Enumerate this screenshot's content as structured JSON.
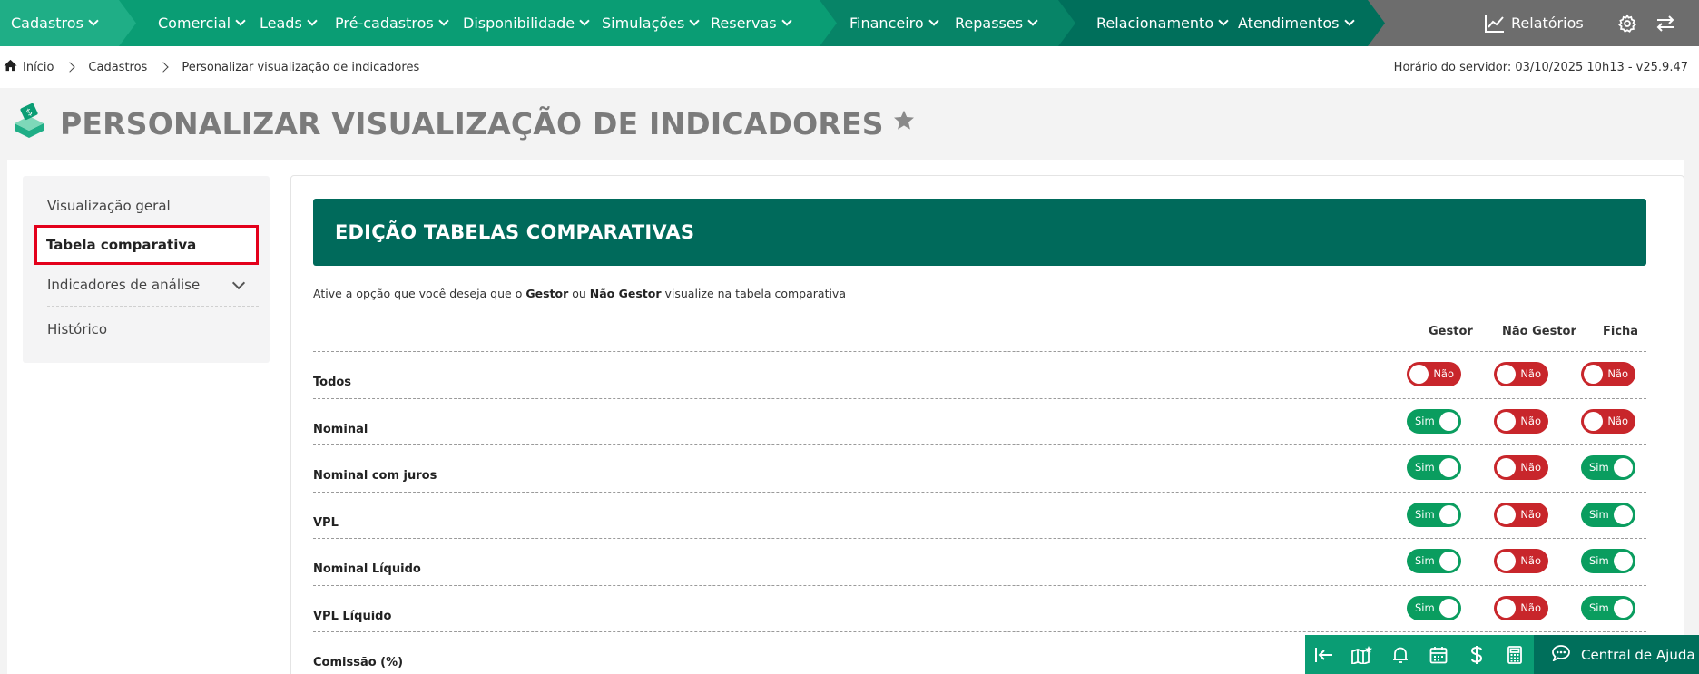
{
  "nav": {
    "items": [
      {
        "label": "Cadastros"
      },
      {
        "label": "Comercial"
      },
      {
        "label": "Leads"
      },
      {
        "label": "Pré-cadastros"
      },
      {
        "label": "Disponibilidade"
      },
      {
        "label": "Simulações"
      },
      {
        "label": "Reservas"
      },
      {
        "label": "Financeiro"
      },
      {
        "label": "Repasses"
      },
      {
        "label": "Relacionamento"
      },
      {
        "label": "Atendimentos"
      }
    ],
    "reports_label": "Relatórios",
    "colors": {
      "seg1": "#1fae86",
      "seg2": "#0a9d74",
      "seg3": "#078467",
      "seg4": "#006f5b",
      "right": "#6d6d6d"
    }
  },
  "breadcrumb": {
    "home": "Início",
    "items": [
      "Cadastros",
      "Personalizar visualização de indicadores"
    ],
    "server_time": "Horário do servidor: 03/10/2025 10h13 - v25.9.47"
  },
  "page": {
    "title": "PERSONALIZAR VISUALIZAÇÃO DE INDICADORES"
  },
  "sidebar": {
    "items": [
      {
        "label": "Visualização geral"
      },
      {
        "label": "Tabela comparativa",
        "active": true
      },
      {
        "label": "Indicadores de análise"
      },
      {
        "label": "Histórico"
      }
    ]
  },
  "content": {
    "banner_title": "EDIÇÃO TABELAS COMPARATIVAS",
    "intro": {
      "p1": "Ative a opção que você deseja que o ",
      "b1": "Gestor",
      "p2": " ou ",
      "b2": "Não Gestor",
      "p3": " visualize na tabela comparativa"
    },
    "columns": [
      "Gestor",
      "Não Gestor",
      "Ficha"
    ],
    "on_label": "Sim",
    "off_label": "Não",
    "rows": [
      {
        "label": "Todos",
        "values": [
          false,
          false,
          false
        ]
      },
      {
        "label": "Nominal",
        "values": [
          true,
          false,
          false
        ]
      },
      {
        "label": "Nominal com juros",
        "values": [
          true,
          false,
          true
        ]
      },
      {
        "label": "VPL",
        "values": [
          true,
          false,
          true
        ]
      },
      {
        "label": "Nominal Líquido",
        "values": [
          true,
          false,
          true
        ]
      },
      {
        "label": "VPL Líquido",
        "values": [
          true,
          false,
          true
        ]
      },
      {
        "label": "Comissão (%)",
        "values": [
          null,
          null,
          null
        ]
      }
    ],
    "colors": {
      "banner": "#006a5b",
      "on": "#0a9d5f",
      "off": "#c8262b",
      "active_border": "#e3001b"
    }
  },
  "footer": {
    "help_label": "Central de Ajuda"
  }
}
